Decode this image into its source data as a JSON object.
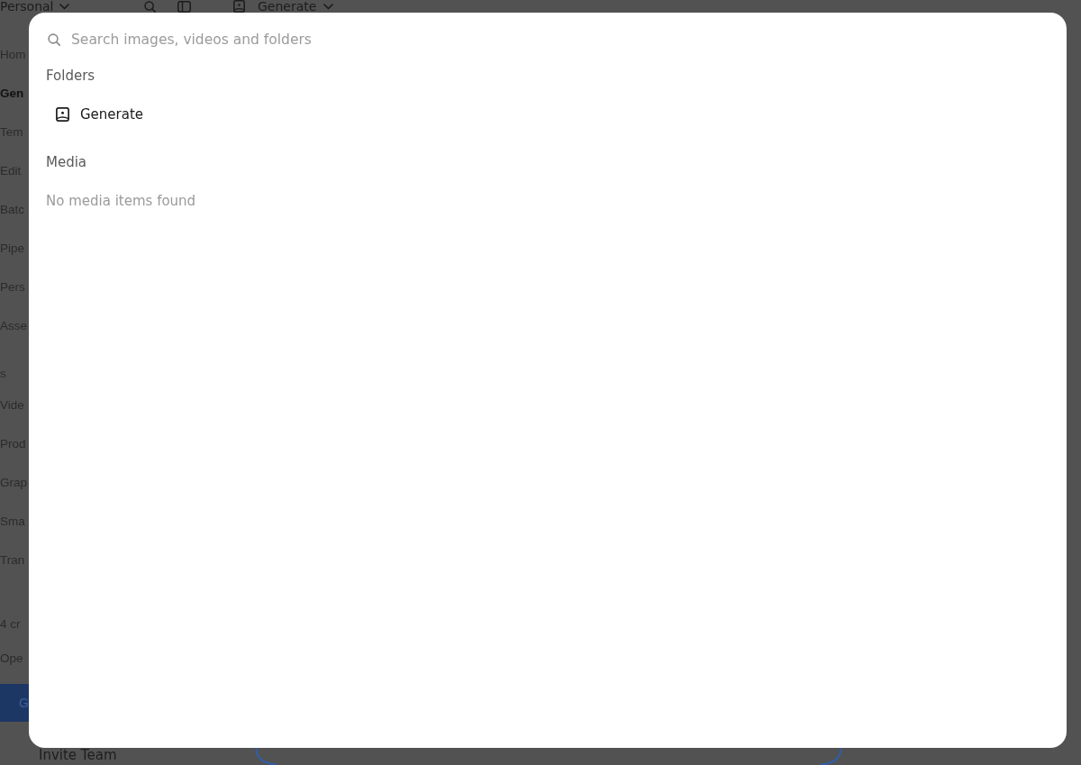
{
  "top_bar": {
    "workspace": "Personal",
    "mode_selector": "Generate"
  },
  "sidebar": {
    "items": [
      {
        "label": "Hom",
        "selected": false
      },
      {
        "label": "Gen",
        "selected": true
      },
      {
        "label": "Tem",
        "selected": false
      },
      {
        "label": "Edit",
        "selected": false
      },
      {
        "label": "Batc",
        "selected": false
      },
      {
        "label": "Pipe",
        "selected": false
      },
      {
        "label": "Pers",
        "selected": false
      },
      {
        "label": "Asse",
        "selected": false
      }
    ],
    "section": {
      "title": "s",
      "items": [
        {
          "label": "Vide",
          "selected": false
        },
        {
          "label": "Prod",
          "selected": false
        },
        {
          "label": "Grap",
          "selected": false
        },
        {
          "label": "Sma",
          "selected": false
        },
        {
          "label": "Tran",
          "selected": false
        }
      ]
    },
    "footer_lines": [
      "4 cr",
      "Ope"
    ],
    "button": "G",
    "invite": "Invite Team"
  },
  "dialog": {
    "search": {
      "placeholder": "Search images, videos and folders"
    },
    "sections": [
      {
        "title": "Folders",
        "items": [
          {
            "label": "Generate"
          }
        ]
      },
      {
        "title": "Media",
        "empty_text": "No media items found"
      }
    ]
  }
}
